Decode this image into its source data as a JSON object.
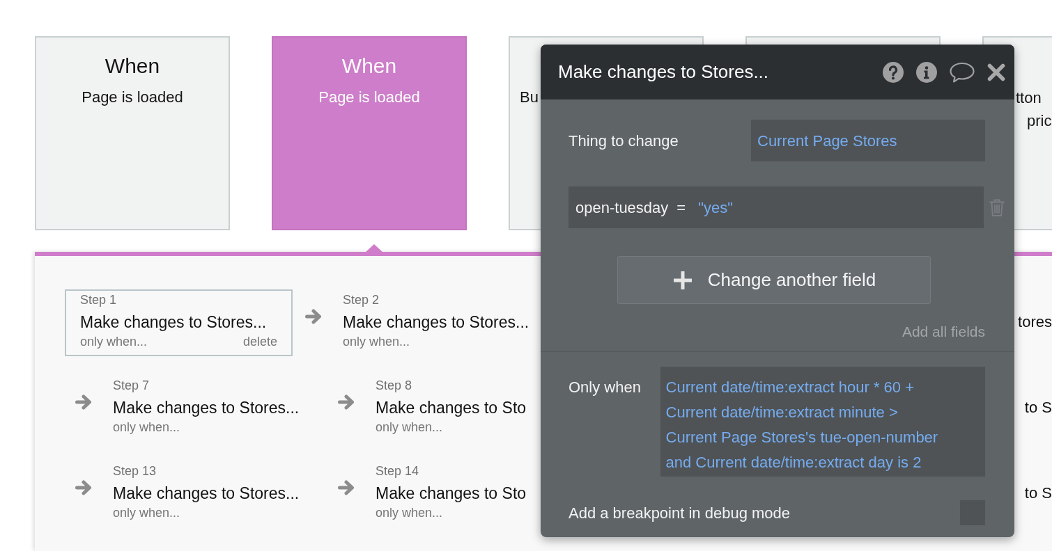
{
  "trigger_cards": [
    {
      "kind": "full",
      "title": "When",
      "event": "Page is loaded",
      "selected": false
    },
    {
      "kind": "full",
      "title": "When",
      "event": "Page is loaded",
      "selected": true
    },
    {
      "kind": "clipped_left",
      "lines": [
        "Bu"
      ],
      "selected": false
    },
    {
      "kind": "covered",
      "selected": false
    },
    {
      "kind": "clipped_right",
      "lines": [
        "tton",
        "pric"
      ],
      "selected": false
    }
  ],
  "workflow_steps": {
    "rows": [
      {
        "steps": [
          {
            "label": "Step 1",
            "action": "Make changes to Stores...",
            "condition": "only when...",
            "delete": "delete",
            "selected": true,
            "arrow_before": false
          },
          {
            "label": "Step 2",
            "action": "Make changes to Stores...",
            "condition": "only when...",
            "selected": false,
            "arrow_before": true
          }
        ],
        "clipped_action": "tores"
      },
      {
        "steps": [
          {
            "label": "Step 7",
            "action": "Make changes to Stores...",
            "condition": "only when...",
            "selected": false,
            "arrow_before": true
          },
          {
            "label": "Step 8",
            "action": "Make changes to Sto",
            "condition": "only when...",
            "selected": false,
            "arrow_before": true
          }
        ],
        "clipped_action": "to S"
      },
      {
        "steps": [
          {
            "label": "Step 13",
            "action": "Make changes to Stores...",
            "condition": "only when...",
            "selected": false,
            "arrow_before": true
          },
          {
            "label": "Step 14",
            "action": "Make changes to Sto",
            "condition": "only when...",
            "selected": false,
            "arrow_before": true
          }
        ],
        "clipped_action": "to S"
      }
    ]
  },
  "popup": {
    "title": "Make changes to Stores...",
    "thing_to_change": {
      "label": "Thing to change",
      "value": "Current Page Stores"
    },
    "fields": [
      {
        "name": "open-tuesday",
        "operator": "=",
        "value": "\"yes\""
      }
    ],
    "add_field_button": "Change another field",
    "add_all_fields": "Add all fields",
    "condition": {
      "label": "Only when",
      "value": "Current date/time:extract hour * 60 +\nCurrent date/time:extract minute >\nCurrent Page Stores's tue-open-number\nand Current date/time:extract day is 2"
    },
    "breakpoint": {
      "label": "Add a breakpoint in debug mode",
      "checked": false
    }
  }
}
